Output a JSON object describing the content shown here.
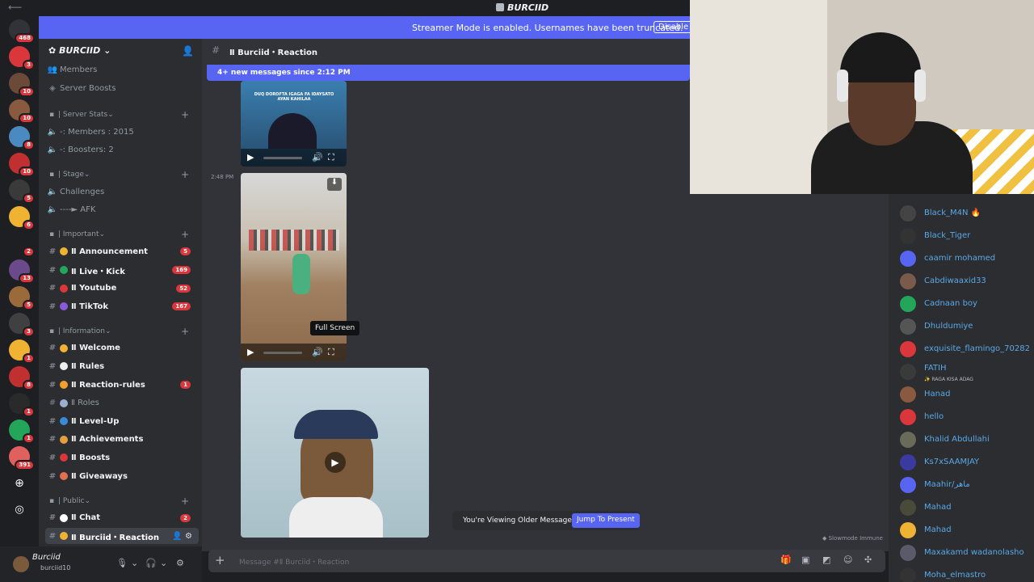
{
  "window": {
    "title": "BURCIID"
  },
  "banner": {
    "text": "Streamer Mode is enabled. Usernames have been truncated.",
    "disable_label": "Disable"
  },
  "server_rail": [
    {
      "badge": "468",
      "color": "#313338"
    },
    {
      "badge": "3",
      "color": "#da373c"
    },
    {
      "badge": "10",
      "color": "#6b4a3a"
    },
    {
      "badge": "10",
      "color": "#8a5a40"
    },
    {
      "badge": "8",
      "color": "#4a8ac0"
    },
    {
      "badge": "10",
      "color": "#c03030"
    },
    {
      "badge": "5",
      "color": "#3a3a3a"
    },
    {
      "badge": "6",
      "color": "#f0b232"
    },
    {
      "badge": "2",
      "color": "#1e1f22"
    },
    {
      "badge": "13",
      "color": "#6a4a8a"
    },
    {
      "badge": "5",
      "color": "#9a6a3a"
    },
    {
      "badge": "3",
      "color": "#404040"
    },
    {
      "badge": "1",
      "color": "#f0b232"
    },
    {
      "badge": "8",
      "color": "#c03030"
    },
    {
      "badge": "1",
      "color": "#2a2a2a"
    },
    {
      "badge": "1",
      "color": "#23a55a"
    },
    {
      "badge": "391",
      "color": "#e06060"
    }
  ],
  "server": {
    "name": "BURCIID"
  },
  "sidebar": {
    "top_items": [
      "Members",
      "Server Boosts"
    ],
    "categories": [
      {
        "label": "| Server Stats",
        "channels": [
          {
            "name": "-: Members : 2015",
            "style": "plain"
          },
          {
            "name": "-: Boosters: 2",
            "style": "plain"
          }
        ]
      },
      {
        "label": "| Stage",
        "channels": [
          {
            "name": "Challenges",
            "style": "plain"
          },
          {
            "name": "----► AFK",
            "style": "plain"
          }
        ]
      },
      {
        "label": "| Important",
        "channels": [
          {
            "name": "Ⅱ Announcement",
            "style": "bold",
            "badge": "5"
          },
          {
            "name": "Ⅱ Live・Kick",
            "style": "bold",
            "badge": "169"
          },
          {
            "name": "Ⅱ Youtube",
            "style": "bold",
            "badge": "52"
          },
          {
            "name": "Ⅱ TikTok",
            "style": "bold",
            "badge": "167"
          }
        ]
      },
      {
        "label": "| Information",
        "channels": [
          {
            "name": "Ⅱ Welcome",
            "style": "bold"
          },
          {
            "name": "Ⅱ Rules",
            "style": "bold"
          },
          {
            "name": "Ⅱ Reaction-rules",
            "style": "bold",
            "badge": "1"
          },
          {
            "name": "Ⅱ Roles",
            "style": "plain"
          },
          {
            "name": "Ⅱ Level-Up",
            "style": "bold"
          },
          {
            "name": "Ⅱ Achievements",
            "style": "bold"
          },
          {
            "name": "Ⅱ Boosts",
            "style": "bold"
          },
          {
            "name": "Ⅱ Giveaways",
            "style": "bold"
          }
        ]
      },
      {
        "label": "| Public",
        "channels": [
          {
            "name": "Ⅱ Chat",
            "style": "bold",
            "badge": "2"
          },
          {
            "name": "Ⅱ Burciid・Reaction",
            "style": "selected"
          }
        ]
      }
    ]
  },
  "user": {
    "name": "Burciid",
    "tag": "burciid10"
  },
  "chat": {
    "channel_title": "Ⅱ Burciid・Reaction",
    "new_messages": "4+ new messages since 2:12 PM",
    "timestamp": "2:48 PM",
    "tooltip": "Full Screen",
    "video1_caption": "DUQ DOROFTA IGAGA FA IDAYSATO AYAN KAHILAA",
    "older_text": "You're Viewing Older Messages",
    "jump_label": "Jump To Present",
    "slowmode": "Slowmode Immune",
    "composer_placeholder": "Message #Ⅱ Burciid・Reaction"
  },
  "members": [
    {
      "name": "Black_M4N 🔥",
      "color": "#444"
    },
    {
      "name": "Black_Tiger",
      "color": "#333"
    },
    {
      "name": "caamir mohamed",
      "color": "#5865f2"
    },
    {
      "name": "Cabdiwaaxid33",
      "color": "#7a5a4a"
    },
    {
      "name": "Cadnaan boy",
      "color": "#23a55a"
    },
    {
      "name": "Dhuldumiye",
      "color": "#555"
    },
    {
      "name": "exquisite_flamingo_70282",
      "color": "#da373c"
    },
    {
      "name": "FATIH",
      "sub": "✨ RAGA KISA ADAG",
      "color": "#3a3a3a"
    },
    {
      "name": "Hanad",
      "color": "#8a5a40"
    },
    {
      "name": "hello",
      "color": "#da373c"
    },
    {
      "name": "Khalid Abdullahi",
      "color": "#6a6a5a"
    },
    {
      "name": "Ks7xSAAMJAY",
      "color": "#3a3aa0"
    },
    {
      "name": "Maahir/ماهر",
      "color": "#5865f2"
    },
    {
      "name": "Mahad",
      "color": "#4a4a3a"
    },
    {
      "name": "Mahad",
      "color": "#f0b232"
    },
    {
      "name": "Maxakamd wadanolasho",
      "color": "#5a5a6a"
    },
    {
      "name": "Moha_elmastro",
      "color": "#333"
    }
  ]
}
